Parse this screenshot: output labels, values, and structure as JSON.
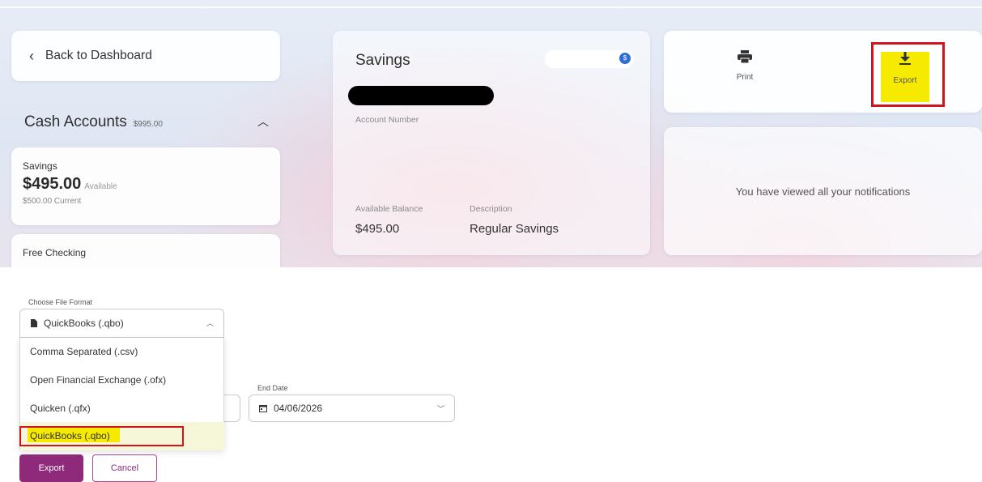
{
  "nav": {
    "back_label": "Back to Dashboard"
  },
  "cash_accounts": {
    "title": "Cash Accounts",
    "total": "$995.00",
    "accounts": [
      {
        "name": "Savings",
        "balance": "$495.00",
        "available_label": "Available",
        "current": "$500.00 Current"
      },
      {
        "name": "Free Checking"
      }
    ]
  },
  "account_detail": {
    "title": "Savings",
    "toggle_badge": "$",
    "account_number_label": "Account Number",
    "available_balance_label": "Available Balance",
    "available_balance": "$495.00",
    "description_label": "Description",
    "description": "Regular Savings"
  },
  "actions": {
    "print_label": "Print",
    "export_label": "Export"
  },
  "notifications": {
    "message": "You have viewed all your notifications"
  },
  "export_dialog": {
    "format_label": "Choose File Format",
    "selected_format": "QuickBooks (.qbo)",
    "options": [
      "Comma Separated (.csv)",
      "Open Financial Exchange (.ofx)",
      "Quicken (.qfx)",
      "QuickBooks (.qbo)"
    ],
    "end_date_label": "End Date",
    "end_date": "04/06/2026",
    "export_button": "Export",
    "cancel_button": "Cancel"
  },
  "colors": {
    "accent": "#8e2a79",
    "highlight": "#f5ea00",
    "annotation": "#d4141c",
    "toggle_dot": "#2e6fd6"
  }
}
